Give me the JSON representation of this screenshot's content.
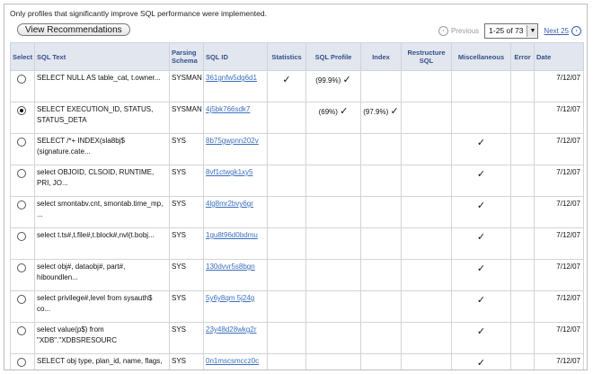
{
  "note": "Only profiles that significantly improve SQL performance were implemented.",
  "view_button": "View Recommendations",
  "pager": {
    "previous": "Previous",
    "range": "1-25 of 73",
    "next": "Next 25"
  },
  "columns": [
    "Select",
    "SQL Text",
    "Parsing Schema",
    "SQL ID",
    "Statistics",
    "SQL Profile",
    "Index",
    "Restructure SQL",
    "Miscellaneous",
    "Error",
    "Date"
  ],
  "rows": [
    {
      "selected": false,
      "sql": "SELECT NULL AS table_cat, t.owner...",
      "schema": "SYSMAN",
      "sqlid": "361gnfw5dg6d1",
      "statistics": true,
      "profile": "(99.9%)",
      "profile_check": true,
      "index": "",
      "index_check": false,
      "misc": false,
      "date": "7/12/07"
    },
    {
      "selected": true,
      "sql": "SELECT EXECUTION_ID, STATUS, STATUS_DETA",
      "schema": "SYSMAN",
      "sqlid": "4j5bk766sdk7",
      "statistics": false,
      "profile": "(69%)",
      "profile_check": true,
      "index": "(97.9%)",
      "index_check": true,
      "misc": false,
      "date": "7/12/07"
    },
    {
      "selected": false,
      "sql": "SELECT /*+ INDEX(sla8bj$ (signature.cate...",
      "schema": "SYS",
      "sqlid": "8b75gwpnn202v",
      "statistics": false,
      "profile": "",
      "profile_check": false,
      "index": "",
      "index_check": false,
      "misc": true,
      "date": "7/12/07"
    },
    {
      "selected": false,
      "sql": "select OBJOID, CLSOID, RUNTIME, PRI, JO...",
      "schema": "SYS",
      "sqlid": "8vf1ctwgk1xy5",
      "statistics": false,
      "profile": "",
      "profile_check": false,
      "index": "",
      "index_check": false,
      "misc": true,
      "date": "7/12/07"
    },
    {
      "selected": false,
      "sql": "select smontabv.cnt, smontab.time_mp, ...",
      "schema": "SYS",
      "sqlid": "4lg8mr2bvy6gr",
      "statistics": false,
      "profile": "",
      "profile_check": false,
      "index": "",
      "index_check": false,
      "misc": true,
      "date": "7/12/07"
    },
    {
      "selected": false,
      "sql": "select t.ts#,t.file#,t.block#,nvl(t.bobj...",
      "schema": "SYS",
      "sqlid": "1gu8t96d0bdmu",
      "statistics": false,
      "profile": "",
      "profile_check": false,
      "index": "",
      "index_check": false,
      "misc": true,
      "date": "7/12/07"
    },
    {
      "selected": false,
      "sql": "select obj#, dataobj#, part#, hiboundlen...",
      "schema": "SYS",
      "sqlid": "130dvvr5s8bgn",
      "statistics": false,
      "profile": "",
      "profile_check": false,
      "index": "",
      "index_check": false,
      "misc": true,
      "date": "7/12/07"
    },
    {
      "selected": false,
      "sql": "select privilege#,level from sysauth$ co...",
      "schema": "SYS",
      "sqlid": "5y6y8qm 5j24g",
      "statistics": false,
      "profile": "",
      "profile_check": false,
      "index": "",
      "index_check": false,
      "misc": true,
      "date": "7/12/07"
    },
    {
      "selected": false,
      "sql": "select value(p$) from \"XDB\".\"XDBSRESOURC",
      "schema": "SYS",
      "sqlid": "23y48d28wkg2r",
      "statistics": false,
      "profile": "",
      "profile_check": false,
      "index": "",
      "index_check": false,
      "misc": true,
      "date": "7/12/07"
    },
    {
      "selected": false,
      "sql": "SELECT obj type, plan_id, name, flags, ...",
      "schema": "SYS",
      "sqlid": "0n1mscsmccz0c",
      "statistics": false,
      "profile": "",
      "profile_check": false,
      "index": "",
      "index_check": false,
      "misc": true,
      "date": "7/12/07"
    }
  ]
}
